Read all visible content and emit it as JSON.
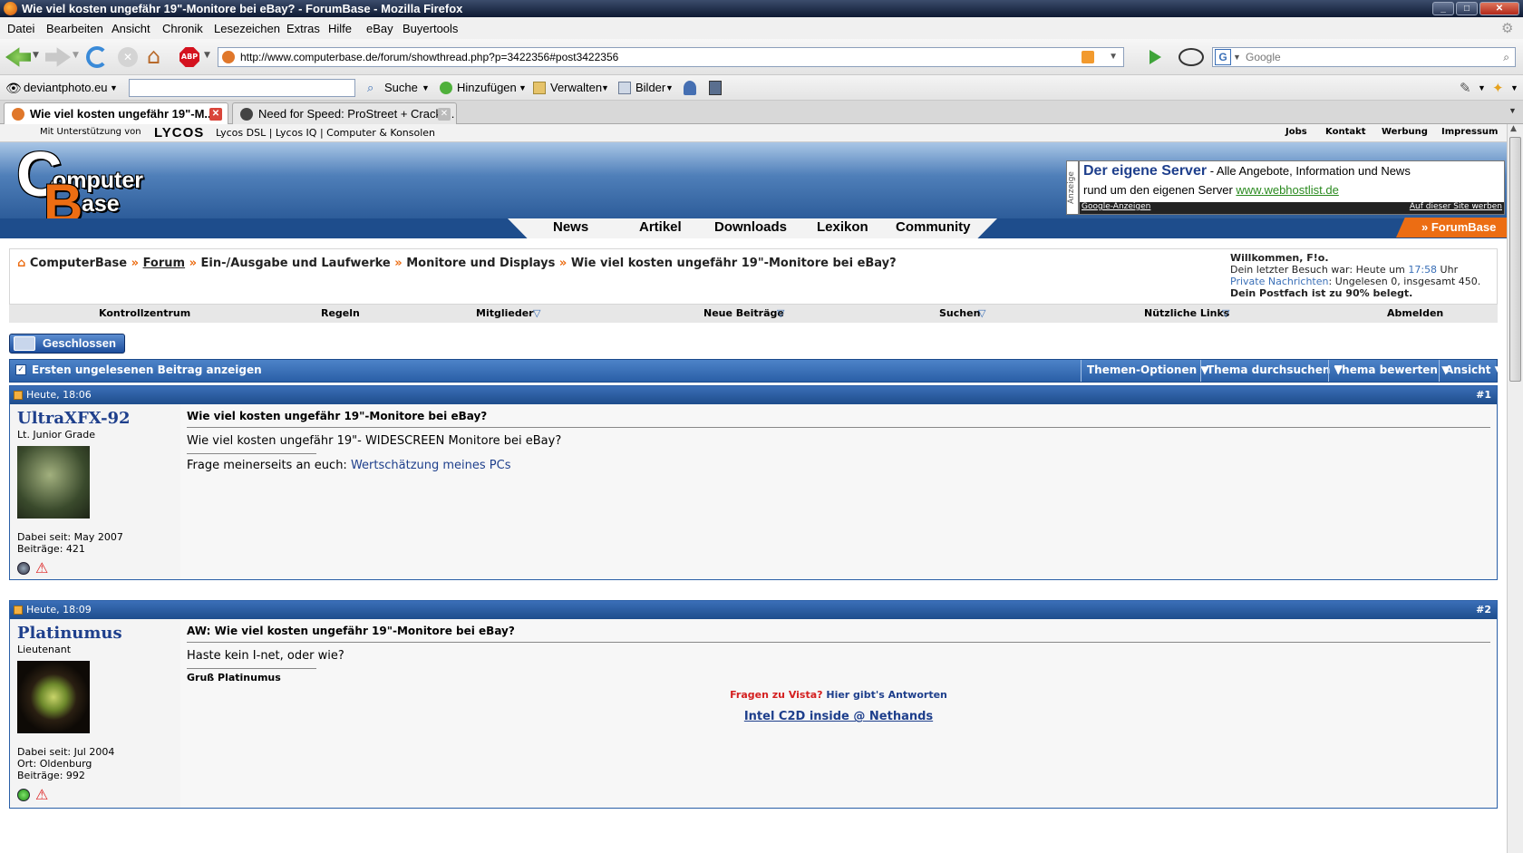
{
  "window": {
    "title": "Wie viel kosten ungefähr 19\"-Monitore bei eBay? - ForumBase - Mozilla Firefox"
  },
  "menu": [
    "Datei",
    "Bearbeiten",
    "Ansicht",
    "Chronik",
    "Lesezeichen",
    "Extras",
    "Hilfe",
    "eBay",
    "Buyertools"
  ],
  "nav": {
    "url": "http://www.computerbase.de/forum/showthread.php?p=3422356#post3422356",
    "search_placeholder": "Google",
    "abp": "ABP"
  },
  "toolbar2": {
    "site": "deviantphoto.eu",
    "search": "Suche",
    "add": "Hinzufügen",
    "manage": "Verwalten",
    "images": "Bilder"
  },
  "tabs": [
    {
      "label": "Wie viel kosten ungefähr 19\"-M...",
      "active": true
    },
    {
      "label": "Need for Speed: ProStreet + Crack ...",
      "active": false
    }
  ],
  "topstrip": {
    "support": "Mit Unterstützung von",
    "brand": "LYCOS",
    "links": "Lycos DSL | Lycos IQ | Computer & Konsolen",
    "right": [
      "Jobs",
      "Kontakt",
      "Werbung",
      "Impressum"
    ]
  },
  "banner": {
    "logo_top": "omputer",
    "logo_bottom": "ase",
    "logo_c": "C",
    "logo_b": "B",
    "ad_side": "Anzeige",
    "ad_title": "Der eigene Server",
    "ad_text1": " - Alle Angebote, Information und News",
    "ad_text2": "rund um den eigenen Server ",
    "ad_link": "www.webhostlist.de",
    "ad_footer_left": "Google-Anzeigen",
    "ad_footer_right": "Auf dieser Site werben"
  },
  "navtabs": [
    "News",
    "Artikel",
    "Downloads",
    "Lexikon",
    "Community"
  ],
  "forumbase": "» ForumBase",
  "breadcrumb": {
    "items": [
      "ComputerBase",
      "Forum",
      "Ein-/Ausgabe und Laufwerke",
      "Monitore und Displays",
      "Wie viel kosten ungefähr 19\"-Monitore bei eBay?"
    ],
    "sep": "»"
  },
  "welcome": {
    "line1": "Willkommen, F!o.",
    "line2a": "Dein letzter Besuch war: Heute um ",
    "line2time": "17:58",
    "line2b": " Uhr",
    "pm_link": "Private Nachrichten",
    "pm_text": ": Ungelesen 0, insgesamt 450.",
    "line4": "Dein Postfach ist zu 90% belegt."
  },
  "ctrl": [
    "Kontrollzentrum",
    "Regeln",
    "Mitglieder",
    "Neue Beiträge",
    "Suchen",
    "Nützliche Links",
    "Abmelden"
  ],
  "closed_button": "Geschlossen",
  "threadbar": {
    "first_unread": "Ersten ungelesenen Beitrag anzeigen",
    "buttons": [
      "Themen-Optionen",
      "Thema durchsuchen",
      "Thema bewerten",
      "Ansicht"
    ]
  },
  "posts": [
    {
      "time": "Heute, 18:06",
      "num": "#1",
      "user": "UltraXFX-92",
      "rank": "Lt. Junior Grade",
      "info": [
        "Dabei seit: May 2007",
        "Beiträge: 421"
      ],
      "title": "Wie viel kosten ungefähr 19\"-Monitore bei eBay?",
      "body": "Wie viel kosten ungefähr 19\"- WIDESCREEN Monitore bei eBay?",
      "sig_prefix": "Frage meinerseits an euch: ",
      "sig_link": "Wertschätzung meines PCs"
    },
    {
      "time": "Heute, 18:09",
      "num": "#2",
      "user": "Platinumus",
      "rank": "Lieutenant",
      "info": [
        "Dabei seit: Jul 2004",
        "Ort: Oldenburg",
        "Beiträge: 992"
      ],
      "title": "AW: Wie viel kosten ungefähr 19\"-Monitore bei eBay?",
      "body": "Haste kein I-net, oder wie?",
      "sig_greet": "Gruß Platinumus",
      "sig_red": "Fragen zu Vista?",
      "sig_blue": " Hier gibt's Antworten",
      "sig_link": "Intel C2D inside @ Nethands"
    }
  ],
  "colors": {
    "accent": "#1e4d8c",
    "orange": "#ec6d13",
    "link": "#1e3f8c"
  }
}
